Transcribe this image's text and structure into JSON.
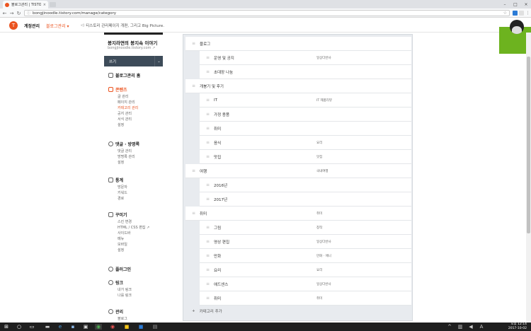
{
  "browser": {
    "tab_title": "블로그관리 | TISTORY",
    "tab_close": "×",
    "url": "bongjinoodle.tistory.com/manage/category",
    "win_min": "–",
    "win_max": "□",
    "win_close": "×"
  },
  "header": {
    "logo": "T",
    "manage": "계정관리",
    "blog_manage": "블로그관리 ▾",
    "notice": "티스토리 관리페이지 개편, 그리고 Big Picture."
  },
  "sidebar": {
    "blog_name": "봉지라면의 봉지속 이야기",
    "blog_url": "bongjinoodle.tistory.com",
    "write": "쓰기",
    "write_arrow": "⌄",
    "home": "블로그관리 홈",
    "contents": "콘텐츠",
    "contents_items": [
      "글 관리",
      "페이지 관리",
      "카테고리 관리",
      "공지 관리",
      "서식 관리",
      "설정"
    ],
    "comments": "댓글 · 방명록",
    "comments_items": [
      "댓글 관리",
      "방명록 관리",
      "설정"
    ],
    "stats": "통계",
    "stats_items": [
      "방문자",
      "키워드",
      "경로"
    ],
    "decorate": "꾸미기",
    "decorate_items": [
      "스킨 변경",
      "HTML / CSS 편집",
      "사이드바",
      "메뉴",
      "모바일",
      "설정"
    ],
    "plugin": "플러그인",
    "link": "링크",
    "link_items": [
      "내가 링크",
      "나를 링크"
    ],
    "admin": "관리",
    "admin_items": [
      "블로그"
    ]
  },
  "categories": [
    {
      "name": "블로그",
      "cat": "",
      "level": 0
    },
    {
      "name": "운영 및 공지",
      "cat": "일상다반사",
      "level": 1
    },
    {
      "name": "초대장 나눔",
      "cat": "",
      "level": 1
    },
    {
      "name": "개봉기 및 후기",
      "cat": "",
      "level": 0
    },
    {
      "name": "IT",
      "cat": "IT 제품리뷰",
      "level": 1
    },
    {
      "name": "가정 용품",
      "cat": "",
      "level": 1
    },
    {
      "name": "취미",
      "cat": "",
      "level": 1
    },
    {
      "name": "음식",
      "cat": "요리",
      "level": 1
    },
    {
      "name": "맛집",
      "cat": "맛집",
      "level": 1
    },
    {
      "name": "여행",
      "cat": "국내여행",
      "level": 0
    },
    {
      "name": "2016년",
      "cat": "",
      "level": 1
    },
    {
      "name": "2017년",
      "cat": "",
      "level": 1
    },
    {
      "name": "취미",
      "cat": "취미",
      "level": 0
    },
    {
      "name": "그림",
      "cat": "창작",
      "level": 1
    },
    {
      "name": "영상 편집",
      "cat": "일상다반사",
      "level": 1
    },
    {
      "name": "만화",
      "cat": "만화 · 애니",
      "level": 1
    },
    {
      "name": "요리",
      "cat": "요리",
      "level": 1
    },
    {
      "name": "애드센스",
      "cat": "일상다반사",
      "level": 1
    },
    {
      "name": "취미",
      "cat": "취미",
      "level": 1
    }
  ],
  "add_category": "카테고리 추가",
  "add_icon": "+",
  "taskbar": {
    "time": "오후 12:14",
    "date": "2017-10-02"
  },
  "colors": {
    "accent": "#eb531f",
    "write_bg": "#3d4b59",
    "green": "#6db31f"
  }
}
